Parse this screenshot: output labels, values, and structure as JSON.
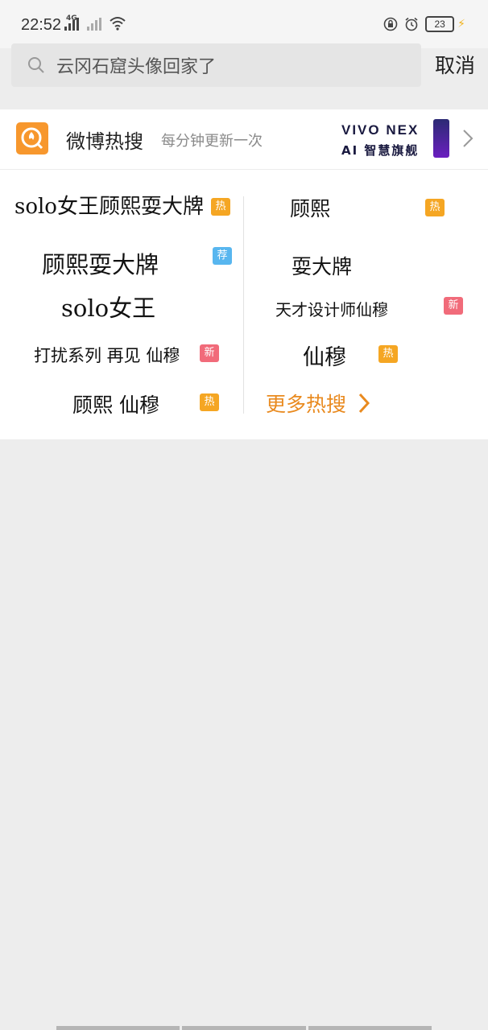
{
  "status_bar": {
    "time": "22:52",
    "network": "4G",
    "battery": "23"
  },
  "search": {
    "query": "云冈石窟头像回家了",
    "cancel_label": "取消"
  },
  "hot_search": {
    "title": "微博热搜",
    "subtitle": "每分钟更新一次",
    "ad_brand": "VIVO NEX",
    "ad_tagline": "AI 智慧旗舰",
    "left": [
      {
        "text": "solo女王顾熙耍大牌",
        "badge": "热"
      },
      {
        "text": "顾熙耍大牌",
        "badge": "荐"
      },
      {
        "text": "solo女王",
        "badge": ""
      },
      {
        "text": "打扰系列 再见 仙穆",
        "badge": "新"
      },
      {
        "text": "顾熙 仙穆",
        "badge": "热"
      }
    ],
    "right": [
      {
        "text": "顾熙",
        "badge": "热"
      },
      {
        "text": "耍大牌",
        "badge": ""
      },
      {
        "text": "天才设计师仙穆",
        "badge": "新"
      },
      {
        "text": "仙穆",
        "badge": "热"
      }
    ],
    "more_label": "更多热搜"
  },
  "colors": {
    "accent": "#e98a1f",
    "hot_badge": "#f5a623",
    "rec_badge": "#58b6ef",
    "new_badge": "#f16b7a"
  }
}
